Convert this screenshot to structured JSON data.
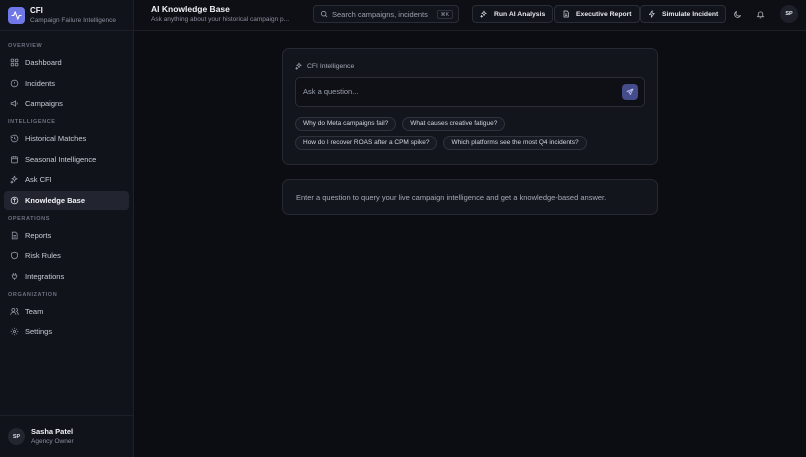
{
  "brand": {
    "name": "CFI",
    "subtitle": "Campaign Failure Intelligence"
  },
  "sidebar": {
    "sections": [
      {
        "title": "OVERVIEW",
        "items": [
          {
            "label": "Dashboard",
            "icon": "dashboard-icon"
          },
          {
            "label": "Incidents",
            "icon": "alert-circle-icon"
          },
          {
            "label": "Campaigns",
            "icon": "megaphone-icon"
          }
        ]
      },
      {
        "title": "INTELLIGENCE",
        "items": [
          {
            "label": "Historical Matches",
            "icon": "history-icon"
          },
          {
            "label": "Seasonal Intelligence",
            "icon": "calendar-icon"
          },
          {
            "label": "Ask CFI",
            "icon": "sparkles-icon"
          },
          {
            "label": "Knowledge Base",
            "icon": "knowledge-icon",
            "active": true
          }
        ]
      },
      {
        "title": "OPERATIONS",
        "items": [
          {
            "label": "Reports",
            "icon": "file-icon"
          },
          {
            "label": "Risk Rules",
            "icon": "shield-icon"
          },
          {
            "label": "Integrations",
            "icon": "plug-icon"
          }
        ]
      },
      {
        "title": "ORGANIZATION",
        "items": [
          {
            "label": "Team",
            "icon": "team-icon"
          },
          {
            "label": "Settings",
            "icon": "gear-icon"
          }
        ]
      }
    ]
  },
  "user": {
    "initials": "SP",
    "name": "Sasha Patel",
    "role": "Agency Owner"
  },
  "header": {
    "title": "AI Knowledge Base",
    "subtitle": "Ask anything about your historical campaign p...",
    "search_placeholder": "Search campaigns, incidents",
    "search_shortcut": "⌘K",
    "run_ai_label": "Run AI Analysis",
    "exec_report_label": "Executive Report",
    "simulate_label": "Simulate Incident",
    "avatar_initials": "SP"
  },
  "ask": {
    "card_label": "CFI Intelligence",
    "placeholder": "Ask a question...",
    "suggestions": [
      [
        "Why do Meta campaigns fail?",
        "What causes creative fatigue?"
      ],
      [
        "How do I recover ROAS after a CPM spike?",
        "Which platforms see the most Q4 incidents?"
      ]
    ]
  },
  "answer": {
    "text": "Enter a question to query your live campaign intelligence and get a knowledge-based answer."
  },
  "colors": {
    "accent": "#6f78e6",
    "send_button": "#444c8c",
    "background": "#0b0d12"
  }
}
